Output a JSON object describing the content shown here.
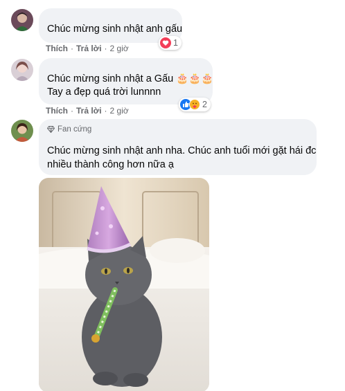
{
  "comments": [
    {
      "text_lines": [
        "Chúc mừng sinh nhật anh gấu"
      ],
      "actions": {
        "like": "Thích",
        "reply": "Trả lời",
        "time": "2 giờ"
      },
      "reactions": {
        "icons": [
          "heart-icon"
        ],
        "count": "1"
      }
    },
    {
      "text_lines": [
        "Chúc mừng sinh nhật a Gấu 🎂🎂🎂",
        "Tay a đẹp quá trời lunnnn"
      ],
      "actions": {
        "like": "Thích",
        "reply": "Trả lời",
        "time": "2 giờ"
      },
      "reactions": {
        "icons": [
          "like-icon",
          "care-icon"
        ],
        "count": "2"
      }
    },
    {
      "badge": "Fan cứng",
      "text_lines": [
        "Chúc mừng sinh nhật anh nha. Chúc anh tuổi mới gặt hái đc",
        "nhiều thành công hơn nữa ạ"
      ],
      "attachment_icon": "birthday-cat-photo"
    }
  ],
  "colors": {
    "bubble": "#f0f2f5",
    "meta_text": "#65676b",
    "like_blue": "#1877f2",
    "heart_red": "#f33e58",
    "care_yellow": "#f7b125"
  }
}
